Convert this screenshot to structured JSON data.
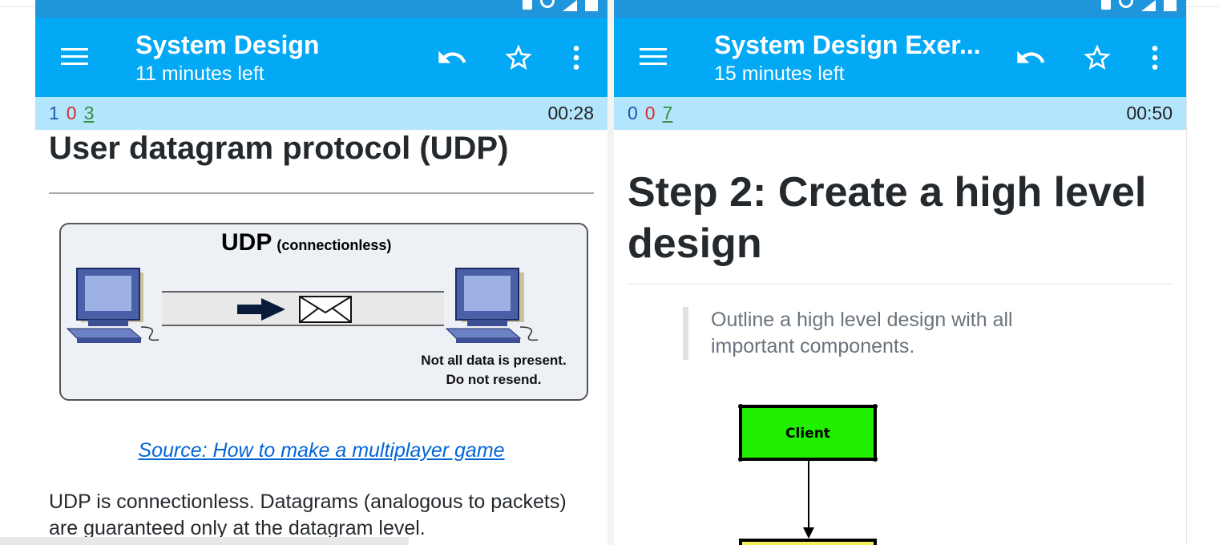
{
  "left": {
    "title": "System Design",
    "subtitle": "11 minutes left",
    "score": {
      "blue": "1",
      "red": "0",
      "green": "3"
    },
    "timer": "00:28",
    "heading": "User datagram protocol (UDP)",
    "figure": {
      "title": "UDP",
      "title_suffix": "(connectionless)",
      "note_line1": "Not all data is present.",
      "note_line2": "Do not resend."
    },
    "caption": "Source: How to make a multiplayer game",
    "paragraph": "UDP is connectionless. Datagrams (analogous to packets) are guaranteed only at the datagram level."
  },
  "right": {
    "title": "System Design Exer...",
    "subtitle": "15 minutes left",
    "score": {
      "blue": "0",
      "red": "0",
      "green": "7"
    },
    "timer": "00:50",
    "heading": "Step 2: Create a high level design",
    "quote": "Outline a high level design with all important components.",
    "diagram": {
      "box_label": "Client"
    }
  },
  "colors": {
    "appbar": "#03a9f4",
    "statusbar": "#1f96db",
    "scorebar": "#b3e5fc",
    "link": "#0366d6",
    "client_box": "#22ee00"
  },
  "icons": [
    "menu-icon",
    "undo-icon",
    "star-icon",
    "more-vert-icon"
  ]
}
